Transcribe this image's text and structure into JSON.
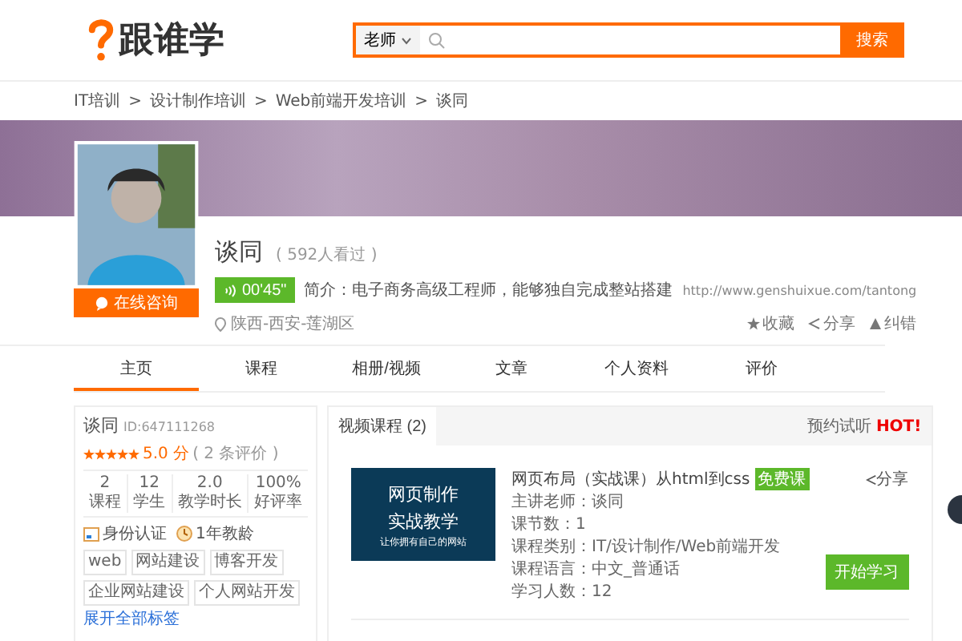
{
  "header": {
    "logo_text": "跟谁学",
    "search": {
      "scope": "老师",
      "button": "搜索"
    }
  },
  "breadcrumb": [
    "IT培训",
    "设计制作培训",
    "Web前端开发培训",
    "谈同"
  ],
  "breadcrumb_separator": ">",
  "profile": {
    "name": "谈同",
    "views": "( 592人看过 )",
    "audio": "00'45\"",
    "intro": "简介：电子商务高级工程师，能够独自完成整站搭建",
    "location": "陕西-西安-莲湖区",
    "url": "http://www.genshuixue.com/tantong",
    "consult_button": "在线咨询",
    "actions": [
      "收藏",
      "分享",
      "纠错"
    ]
  },
  "tabs": [
    {
      "label": "主页",
      "selected": true
    },
    {
      "label": "课程",
      "selected": false
    },
    {
      "label": "相册/视频",
      "selected": false
    },
    {
      "label": "文章",
      "selected": false
    },
    {
      "label": "个人资料",
      "selected": false
    },
    {
      "label": "评价",
      "selected": false
    }
  ],
  "card": {
    "name": "谈同",
    "id": "ID:647111268",
    "stars": 5,
    "score": "5.0 分",
    "reviews": "( 2 条评价 )",
    "stats": [
      {
        "value": "2",
        "label": "课程"
      },
      {
        "value": "12",
        "label": "学生"
      },
      {
        "value": "2.0",
        "label": "教学时长"
      },
      {
        "value": "100%",
        "label": "好评率"
      }
    ],
    "badges": [
      "身份认证",
      "1年教龄"
    ],
    "tags": [
      "web",
      "网站建设",
      "博客开发",
      "企业网站建设",
      "个人网站开发"
    ],
    "more_link": "展开全部标签"
  },
  "courses_panel": {
    "tab": "视频课程 (2)",
    "trial": "预约试听",
    "hot": "HOT!",
    "course": {
      "thumb_lines": [
        "网页制作",
        "实战教学",
        "让你拥有自己的网站"
      ],
      "title": "网页布局（实战课）从html到css",
      "badge": "免费课",
      "share": "分享",
      "details": [
        "主讲老师：谈同",
        "课节数：1",
        "课程类别：IT/设计制作/Web前端开发",
        "课程语言：中文_普通话",
        "学习人数：12"
      ],
      "button": "开始学习"
    }
  }
}
